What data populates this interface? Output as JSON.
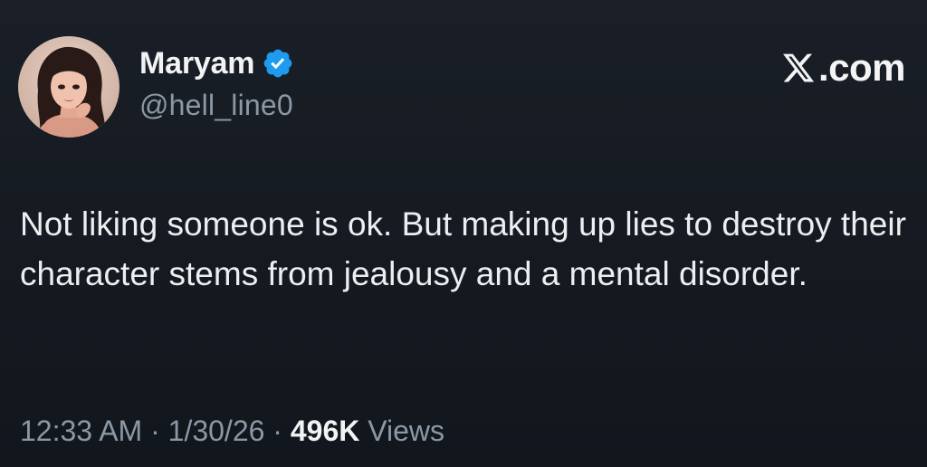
{
  "author": {
    "display_name": "Maryam",
    "handle": "@hell_line0",
    "verified": true,
    "avatar_icon": "profile-avatar-illustration"
  },
  "brand": {
    "text": ".com",
    "icon": "x-logo-icon"
  },
  "tweet": {
    "text": "Not liking someone is ok. But making up lies to destroy their character stems from jealousy and a mental disorder."
  },
  "meta": {
    "time": "12:33 AM",
    "separator": "·",
    "date": "1/30/26",
    "views_count": "496K",
    "views_label": "Views"
  },
  "colors": {
    "background": "#161b22",
    "text_primary": "#e7e9ea",
    "text_secondary": "#8b98a5",
    "verified_blue": "#1d9bf0"
  }
}
